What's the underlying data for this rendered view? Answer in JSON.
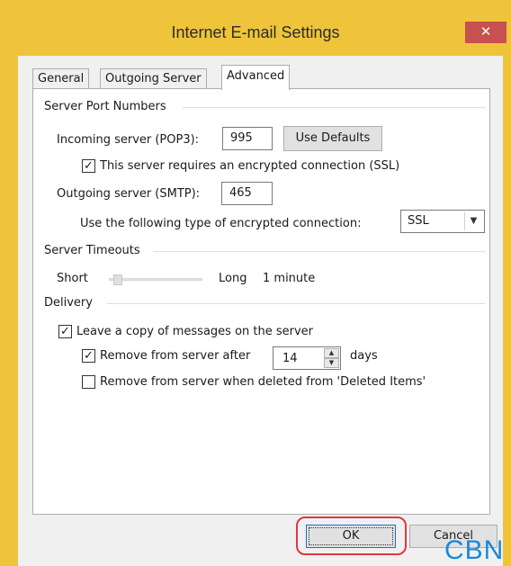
{
  "window": {
    "title": "Internet E-mail Settings",
    "close_glyph": "✕"
  },
  "tabs": [
    {
      "label": "General"
    },
    {
      "label": "Outgoing Server"
    },
    {
      "label": "Advanced"
    }
  ],
  "active_tab": "Advanced",
  "server_ports": {
    "group_label": "Server Port Numbers",
    "incoming_label": "Incoming server (POP3):",
    "incoming_value": "995",
    "use_defaults_label": "Use Defaults",
    "ssl_required_label": "This server requires an encrypted connection (SSL)",
    "ssl_required_checked": true,
    "outgoing_label": "Outgoing server (SMTP):",
    "outgoing_value": "465",
    "encryption_label": "Use the following type of encrypted connection:",
    "encryption_value": "SSL"
  },
  "timeouts": {
    "group_label": "Server Timeouts",
    "short_label": "Short",
    "long_label": "Long",
    "value_label": "1 minute",
    "slider_fraction": 0.05
  },
  "delivery": {
    "group_label": "Delivery",
    "leave_copy_label": "Leave a copy of messages on the server",
    "leave_copy_checked": true,
    "remove_after_label": "Remove from server after",
    "remove_after_checked": true,
    "remove_after_days": "14",
    "days_label": "days",
    "remove_deleted_label": "Remove from server when deleted from 'Deleted Items'",
    "remove_deleted_checked": false
  },
  "footer": {
    "ok_label": "OK",
    "cancel_label": "Cancel"
  },
  "watermark": "CBN",
  "colors": {
    "frame": "#f0c43a",
    "close": "#c75050",
    "highlight": "#e2373f",
    "watermark": "#1a88d9"
  }
}
